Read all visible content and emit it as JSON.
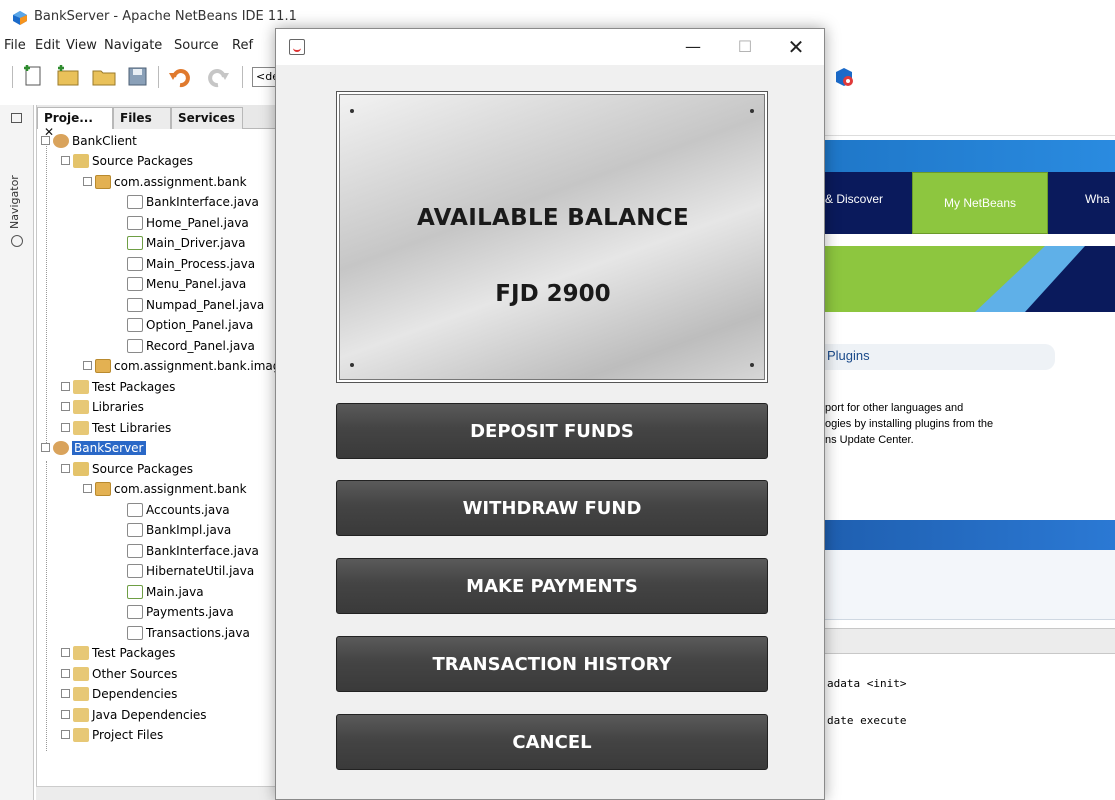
{
  "ide": {
    "window_title": "BankServer - Apache NetBeans IDE 11.1",
    "menu": [
      "File",
      "Edit",
      "View",
      "Navigate",
      "Source",
      "Ref"
    ],
    "config_combo": "<de",
    "navigator_label": "Navigator",
    "panel_tabs": [
      "Proje...",
      "Files",
      "Services"
    ],
    "tree": [
      {
        "label": "BankClient",
        "type": "proj"
      },
      {
        "label": "Source Packages",
        "type": "pkgfolder"
      },
      {
        "label": "com.assignment.bank",
        "type": "pkg"
      },
      {
        "label": "BankInterface.java",
        "type": "java"
      },
      {
        "label": "Home_Panel.java",
        "type": "java"
      },
      {
        "label": "Main_Driver.java",
        "type": "javarun"
      },
      {
        "label": "Main_Process.java",
        "type": "java"
      },
      {
        "label": "Menu_Panel.java",
        "type": "java"
      },
      {
        "label": "Numpad_Panel.java",
        "type": "java"
      },
      {
        "label": "Option_Panel.java",
        "type": "java"
      },
      {
        "label": "Record_Panel.java",
        "type": "java"
      },
      {
        "label": "com.assignment.bank.imag",
        "type": "pkg"
      },
      {
        "label": "Test Packages",
        "type": "folder"
      },
      {
        "label": "Libraries",
        "type": "folder"
      },
      {
        "label": "Test Libraries",
        "type": "folder"
      },
      {
        "label": "BankServer",
        "type": "proj"
      },
      {
        "label": "Source Packages",
        "type": "pkgfolder"
      },
      {
        "label": "com.assignment.bank",
        "type": "pkg"
      },
      {
        "label": "Accounts.java",
        "type": "java"
      },
      {
        "label": "BankImpl.java",
        "type": "java"
      },
      {
        "label": "BankInterface.java",
        "type": "java"
      },
      {
        "label": "HibernateUtil.java",
        "type": "java"
      },
      {
        "label": "Main.java",
        "type": "javarun"
      },
      {
        "label": "Payments.java",
        "type": "java"
      },
      {
        "label": "Transactions.java",
        "type": "java"
      },
      {
        "label": "Test Packages",
        "type": "folder"
      },
      {
        "label": "Other Sources",
        "type": "folder"
      },
      {
        "label": "Dependencies",
        "type": "folder"
      },
      {
        "label": "Java Dependencies",
        "type": "folder"
      },
      {
        "label": "Project Files",
        "type": "folder"
      }
    ],
    "right_panel": {
      "nav_items": [
        "& Discover",
        "My NetBeans",
        "Wha"
      ],
      "plugins_heading": "Plugins",
      "plugins_text": [
        "port for other languages and",
        "ogies by installing plugins from the",
        "ns Update Center."
      ],
      "output_lines": [
        "adata <init>",
        "date execute"
      ]
    }
  },
  "dialog": {
    "balance_title": "AVAILABLE BALANCE",
    "balance_amount": "FJD 2900",
    "buttons": {
      "deposit": "DEPOSIT FUNDS",
      "withdraw": "WITHDRAW FUND",
      "payments": "MAKE PAYMENTS",
      "history": "TRANSACTION HISTORY",
      "cancel": "CANCEL"
    },
    "window_controls": {
      "minimize": "—",
      "maximize": "☐",
      "close": "✕"
    }
  },
  "colors": {
    "button_bg": "#444444",
    "button_text": "#ffffff",
    "nav_blue": "#0a1a5c",
    "nav_green": "#8dc63f",
    "selection_blue": "#2a68c7"
  }
}
